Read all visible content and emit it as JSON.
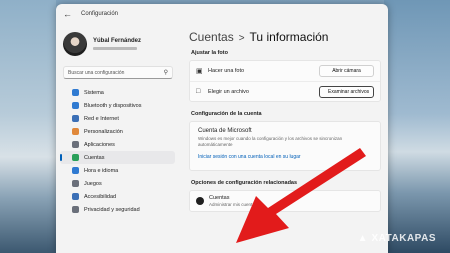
{
  "window": {
    "title": "Configuración"
  },
  "profile": {
    "name": "Yúbal Fernández"
  },
  "search": {
    "placeholder": "Buscar una configuración"
  },
  "sidebar": {
    "items": [
      {
        "label": "Sistema",
        "icon": "monitor-icon",
        "color": "#2f7ad1"
      },
      {
        "label": "Bluetooth y dispositivos",
        "icon": "bluetooth-icon",
        "color": "#2f7ad1"
      },
      {
        "label": "Red e Internet",
        "icon": "network-icon",
        "color": "#3b6fb6"
      },
      {
        "label": "Personalización",
        "icon": "brush-icon",
        "color": "#e0883a"
      },
      {
        "label": "Aplicaciones",
        "icon": "apps-icon",
        "color": "#6a6f7a"
      },
      {
        "label": "Cuentas",
        "icon": "person-icon",
        "color": "#2aa05a",
        "active": true
      },
      {
        "label": "Hora e idioma",
        "icon": "globe-clock-icon",
        "color": "#2f7ad1"
      },
      {
        "label": "Juegos",
        "icon": "gamepad-icon",
        "color": "#6a6f7a"
      },
      {
        "label": "Accesibilidad",
        "icon": "accessibility-icon",
        "color": "#3b6fb6"
      },
      {
        "label": "Privacidad y seguridad",
        "icon": "shield-icon",
        "color": "#6a6f7a"
      }
    ]
  },
  "breadcrumb": {
    "parent": "Cuentas",
    "separator": ">",
    "current": "Tu información"
  },
  "photo": {
    "section_title": "Ajustar la foto",
    "camera_label": "Hacer una foto",
    "camera_button": "Abrir cámara",
    "file_label": "Elegir un archivo",
    "file_button": "Examinar archivos"
  },
  "account_config": {
    "section_title": "Configuración de la cuenta",
    "title": "Cuenta de Microsoft",
    "description": "Windows es mejor cuando la configuración y los archivos se sincronizan automáticamente",
    "link": "Iniciar sesión con una cuenta local en su lugar"
  },
  "related": {
    "section_title": "Opciones de configuración relacionadas",
    "title": "Cuentas",
    "subtitle": "Administrar mis cuentas"
  },
  "watermark": {
    "text": "XATAKAPAS"
  },
  "colors": {
    "accent": "#005fb8",
    "arrow": "#e21b1b"
  }
}
